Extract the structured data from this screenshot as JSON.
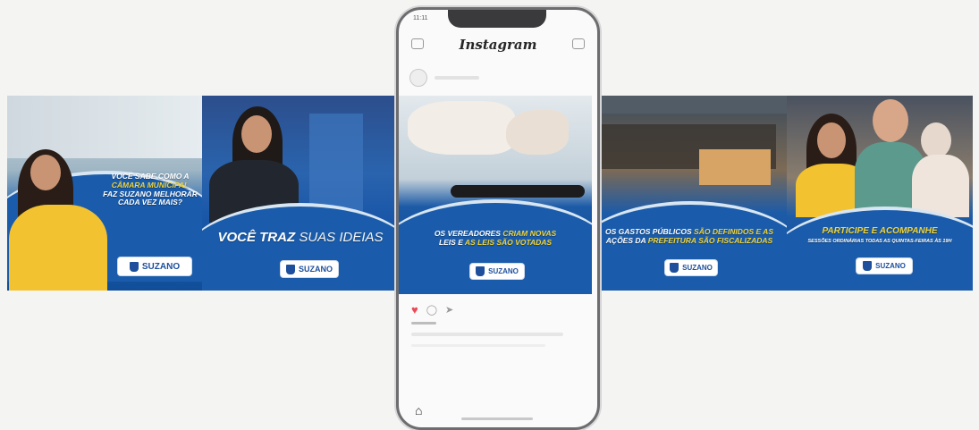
{
  "panels": [
    {
      "caption_lines": [
        "VOCÊ SABE COMO A",
        "CÂMARA MUNICIPAL",
        "FAZ SUZANO MELHORAR",
        "CADA VEZ MAIS?"
      ],
      "logo": "SUZANO"
    },
    {
      "caption_main": "VOCÊ TRAZ",
      "caption_highlight": "SUAS IDEIAS",
      "logo": "SUZANO"
    },
    {
      "caption_line1_a": "OS VEREADORES",
      "caption_line1_hl": "CRIAM NOVAS",
      "caption_line2_a": "LEIS E",
      "caption_line2_hl": "AS LEIS SÃO VOTADAS",
      "logo": "SUZANO"
    },
    {
      "caption_line1_a": "OS GASTOS PÚBLICOS",
      "caption_line1_hl": "SÃO DEFINIDOS E AS",
      "caption_line2_a": "AÇÕES DA",
      "caption_line2_hl": "PREFEITURA SÃO FISCALIZADAS",
      "logo": "SUZANO"
    },
    {
      "caption_title": "PARTICIPE E ACOMPANHE",
      "caption_sub": "SESSÕES ORDINÁRIAS TODAS AS QUINTAS-FEIRAS ÀS 19H",
      "logo": "SUZANO"
    }
  ],
  "phone": {
    "app_title": "Instagram",
    "status_time": "11:11"
  },
  "colors": {
    "accent_blue": "#1a5cab",
    "highlight_yellow": "#f2d437",
    "like_red": "#ed4956"
  }
}
